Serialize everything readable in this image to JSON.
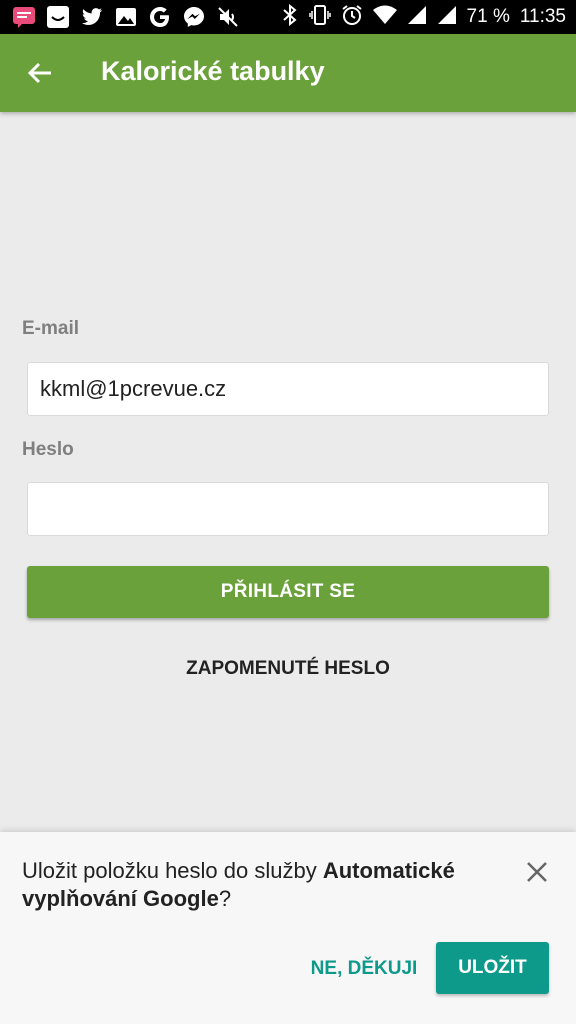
{
  "status_bar": {
    "left_icons": [
      "message-app-icon",
      "notification-face-icon",
      "twitter-icon",
      "gallery-icon",
      "google-icon",
      "messenger-icon",
      "mute-icon"
    ],
    "right_icons": [
      "bluetooth-icon",
      "vibrate-icon",
      "alarm-icon",
      "wifi-icon",
      "signal-icon",
      "signal-icon"
    ],
    "battery": "71 %",
    "time": "11:35"
  },
  "app_bar": {
    "title": "Kalorické tabulky",
    "color": "#6aa13a"
  },
  "form": {
    "email_label": "E-mail",
    "email_value": "kkml@1pcrevue.cz",
    "password_label": "Heslo",
    "password_value": "",
    "login_button": "PŘIHLÁSIT SE",
    "forgot_link": "ZAPOMENUTÉ HESLO"
  },
  "autofill_sheet": {
    "text_prefix": "Uložit položku heslo do služby ",
    "text_bold": "Automatické vyplňování Google",
    "text_suffix": "?",
    "decline_button": "NE, DĚKUJI",
    "save_button": "ULOŽIT",
    "accent": "#0e9a8a"
  }
}
